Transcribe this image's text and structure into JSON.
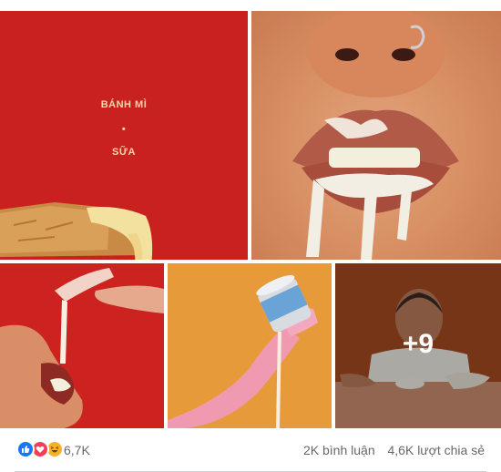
{
  "post_grid": {
    "tile1": {
      "caption_line1": "BÁNH MÌ",
      "caption_sep": "•",
      "caption_line2": "SỮA"
    },
    "tile5": {
      "more_count": "+9"
    }
  },
  "footer": {
    "reaction_count": "6,7K",
    "comments": "2K bình luận",
    "shares": "4,6K lượt chia sẻ"
  },
  "reactions": [
    "like-icon",
    "love-icon",
    "haha-icon"
  ],
  "colors": {
    "like": "#1877f2",
    "love": "#f33e58",
    "haha": "#f7b125",
    "meta_text": "#65676b"
  }
}
